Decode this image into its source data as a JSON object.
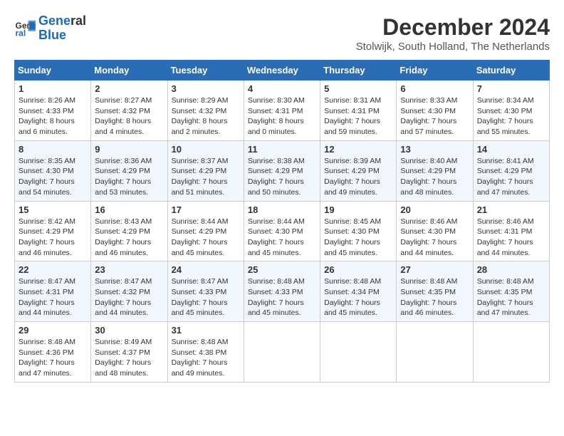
{
  "logo": {
    "line1": "General",
    "line2": "Blue"
  },
  "title": "December 2024",
  "subtitle": "Stolwijk, South Holland, The Netherlands",
  "weekdays": [
    "Sunday",
    "Monday",
    "Tuesday",
    "Wednesday",
    "Thursday",
    "Friday",
    "Saturday"
  ],
  "weeks": [
    [
      {
        "day": "1",
        "sunrise": "8:26 AM",
        "sunset": "4:33 PM",
        "daylight": "8 hours and 6 minutes."
      },
      {
        "day": "2",
        "sunrise": "8:27 AM",
        "sunset": "4:32 PM",
        "daylight": "8 hours and 4 minutes."
      },
      {
        "day": "3",
        "sunrise": "8:29 AM",
        "sunset": "4:32 PM",
        "daylight": "8 hours and 2 minutes."
      },
      {
        "day": "4",
        "sunrise": "8:30 AM",
        "sunset": "4:31 PM",
        "daylight": "8 hours and 0 minutes."
      },
      {
        "day": "5",
        "sunrise": "8:31 AM",
        "sunset": "4:31 PM",
        "daylight": "7 hours and 59 minutes."
      },
      {
        "day": "6",
        "sunrise": "8:33 AM",
        "sunset": "4:30 PM",
        "daylight": "7 hours and 57 minutes."
      },
      {
        "day": "7",
        "sunrise": "8:34 AM",
        "sunset": "4:30 PM",
        "daylight": "7 hours and 55 minutes."
      }
    ],
    [
      {
        "day": "8",
        "sunrise": "8:35 AM",
        "sunset": "4:30 PM",
        "daylight": "7 hours and 54 minutes."
      },
      {
        "day": "9",
        "sunrise": "8:36 AM",
        "sunset": "4:29 PM",
        "daylight": "7 hours and 53 minutes."
      },
      {
        "day": "10",
        "sunrise": "8:37 AM",
        "sunset": "4:29 PM",
        "daylight": "7 hours and 51 minutes."
      },
      {
        "day": "11",
        "sunrise": "8:38 AM",
        "sunset": "4:29 PM",
        "daylight": "7 hours and 50 minutes."
      },
      {
        "day": "12",
        "sunrise": "8:39 AM",
        "sunset": "4:29 PM",
        "daylight": "7 hours and 49 minutes."
      },
      {
        "day": "13",
        "sunrise": "8:40 AM",
        "sunset": "4:29 PM",
        "daylight": "7 hours and 48 minutes."
      },
      {
        "day": "14",
        "sunrise": "8:41 AM",
        "sunset": "4:29 PM",
        "daylight": "7 hours and 47 minutes."
      }
    ],
    [
      {
        "day": "15",
        "sunrise": "8:42 AM",
        "sunset": "4:29 PM",
        "daylight": "7 hours and 46 minutes."
      },
      {
        "day": "16",
        "sunrise": "8:43 AM",
        "sunset": "4:29 PM",
        "daylight": "7 hours and 46 minutes."
      },
      {
        "day": "17",
        "sunrise": "8:44 AM",
        "sunset": "4:29 PM",
        "daylight": "7 hours and 45 minutes."
      },
      {
        "day": "18",
        "sunrise": "8:44 AM",
        "sunset": "4:30 PM",
        "daylight": "7 hours and 45 minutes."
      },
      {
        "day": "19",
        "sunrise": "8:45 AM",
        "sunset": "4:30 PM",
        "daylight": "7 hours and 45 minutes."
      },
      {
        "day": "20",
        "sunrise": "8:46 AM",
        "sunset": "4:30 PM",
        "daylight": "7 hours and 44 minutes."
      },
      {
        "day": "21",
        "sunrise": "8:46 AM",
        "sunset": "4:31 PM",
        "daylight": "7 hours and 44 minutes."
      }
    ],
    [
      {
        "day": "22",
        "sunrise": "8:47 AM",
        "sunset": "4:31 PM",
        "daylight": "7 hours and 44 minutes."
      },
      {
        "day": "23",
        "sunrise": "8:47 AM",
        "sunset": "4:32 PM",
        "daylight": "7 hours and 44 minutes."
      },
      {
        "day": "24",
        "sunrise": "8:47 AM",
        "sunset": "4:33 PM",
        "daylight": "7 hours and 45 minutes."
      },
      {
        "day": "25",
        "sunrise": "8:48 AM",
        "sunset": "4:33 PM",
        "daylight": "7 hours and 45 minutes."
      },
      {
        "day": "26",
        "sunrise": "8:48 AM",
        "sunset": "4:34 PM",
        "daylight": "7 hours and 45 minutes."
      },
      {
        "day": "27",
        "sunrise": "8:48 AM",
        "sunset": "4:35 PM",
        "daylight": "7 hours and 46 minutes."
      },
      {
        "day": "28",
        "sunrise": "8:48 AM",
        "sunset": "4:35 PM",
        "daylight": "7 hours and 47 minutes."
      }
    ],
    [
      {
        "day": "29",
        "sunrise": "8:48 AM",
        "sunset": "4:36 PM",
        "daylight": "7 hours and 47 minutes."
      },
      {
        "day": "30",
        "sunrise": "8:49 AM",
        "sunset": "4:37 PM",
        "daylight": "7 hours and 48 minutes."
      },
      {
        "day": "31",
        "sunrise": "8:48 AM",
        "sunset": "4:38 PM",
        "daylight": "7 hours and 49 minutes."
      },
      null,
      null,
      null,
      null
    ]
  ]
}
